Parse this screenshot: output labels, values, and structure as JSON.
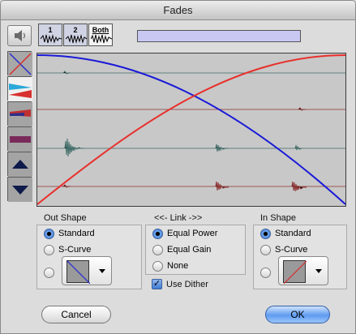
{
  "window": {
    "title": "Fades"
  },
  "toolbar": {
    "audition_icon": "speaker-icon",
    "track_buttons": [
      {
        "label": "1"
      },
      {
        "label": "2"
      },
      {
        "label": "Both"
      }
    ]
  },
  "tools": [
    {
      "icon": "crossfade-icon"
    },
    {
      "icon": "fade-in-out-icon"
    },
    {
      "icon": "overlay-icon"
    },
    {
      "icon": "block-icon"
    },
    {
      "icon": "arrow-up-icon"
    },
    {
      "icon": "arrow-down-icon"
    }
  ],
  "colors": {
    "fade_out_curve": "#1a1ad8",
    "fade_in_curve": "#e8302c",
    "waveform_top": "#3e6b66",
    "waveform_bottom": "#8c3030",
    "display_bg": "#c8c8c8"
  },
  "out_shape": {
    "label": "Out Shape",
    "options": [
      "Standard",
      "S-Curve"
    ],
    "selected": "Standard"
  },
  "link": {
    "label": "<<- Link ->>",
    "options": [
      "Equal Power",
      "Equal Gain",
      "None"
    ],
    "selected": "Equal Power",
    "dither_label": "Use Dither",
    "dither_checked": true
  },
  "in_shape": {
    "label": "In Shape",
    "options": [
      "Standard",
      "S-Curve"
    ],
    "selected": "Standard"
  },
  "buttons": {
    "cancel": "Cancel",
    "ok": "OK"
  }
}
